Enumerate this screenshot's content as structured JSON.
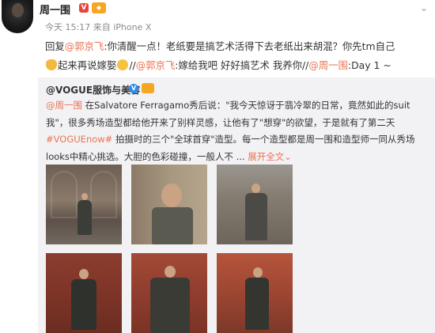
{
  "post": {
    "username": "周一围",
    "verified_badge": "V",
    "timestamp": "今天 15:17",
    "source": "来自 iPhone X",
    "menu_caret": "⌄"
  },
  "reply": {
    "prefix": "回复",
    "mention1": "@郭京飞",
    "text1": ":你清醒一点！老纸要是搞艺术活得下去老纸出来胡混？你先tm自己",
    "text2": "起来再说嫁娶",
    "sep1": "//",
    "mention2": "@郭京飞",
    "text3": ":嫁给我吧 好好搞艺术 我养你//",
    "mention3": "@周一围",
    "text4": ":Day 1 ~"
  },
  "quote": {
    "author": "@VOGUE服饰与美容",
    "verified": "V",
    "mention": "@周一围",
    "body1": " 在Salvatore Ferragamo秀后说：\"我今天惊讶于翡冷翠的日常，竟然如此的suit我\"，很多秀场造型都给他开来了别样灵感，让他有了\"想穿\"的欲望，于是就有了第二天",
    "hashtag": "#VOGUEnow#",
    "body2": " 拍摄时的三个\"全球首穿\"造型。每一个造型都是周一围和造型师一同从秀场looks中精心挑选。大胆的色彩碰撞，一般人不 ... ",
    "expand": "展开全文",
    "expand_caret": "⌄"
  },
  "colors": {
    "link": "#eb7350",
    "quote_bg": "#f2f2f5",
    "verified_red": "#e8433d",
    "verified_blue": "#2a8cf0",
    "badge_orange": "#f5a623"
  }
}
